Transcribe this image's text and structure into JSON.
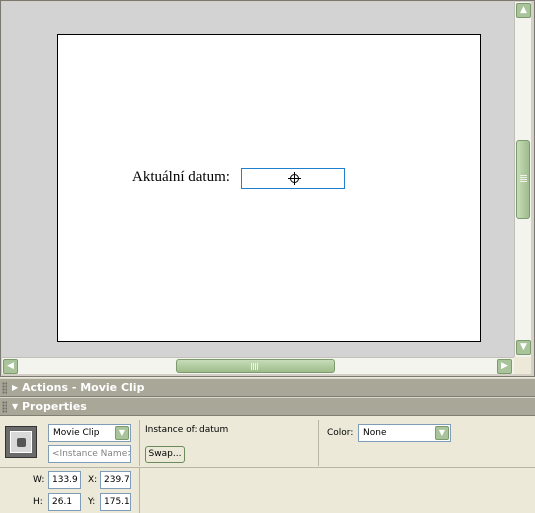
{
  "stage": {
    "label_text": "Aktuální datum:"
  },
  "scrollbars": {
    "up_arrow": "▲",
    "down_arrow": "▼",
    "left_arrow": "◀",
    "right_arrow": "▶"
  },
  "panels": {
    "actions": {
      "title": "Actions - Movie Clip",
      "arrow": "▶"
    },
    "properties": {
      "title": "Properties",
      "arrow": "▼"
    }
  },
  "properties": {
    "symbol_type": "Movie Clip",
    "instance_name_placeholder": "<Instance Name>",
    "instance_of_label": "Instance of:",
    "instance_of_value": "datum",
    "swap_label": "Swap...",
    "color_label": "Color:",
    "color_value": "None",
    "dropdown_arrow": "▼",
    "w_label": "W:",
    "w_value": "133.9",
    "h_label": "H:",
    "h_value": "26.1",
    "x_label": "X:",
    "x_value": "239.7",
    "y_label": "Y:",
    "y_value": "175.1"
  },
  "colors": {
    "scroll_green": "#a9c49a",
    "panel_header": "#a8a798",
    "selection_blue": "#1f7fd0"
  }
}
